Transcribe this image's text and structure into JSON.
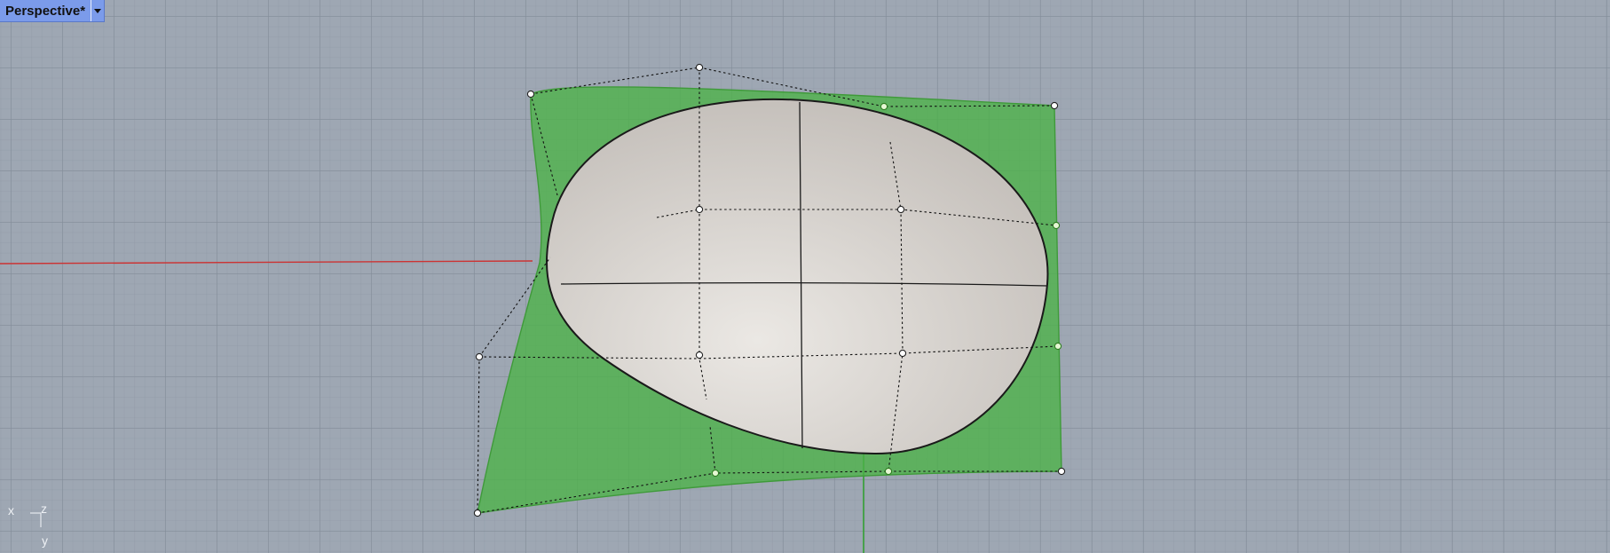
{
  "viewport": {
    "title": "Perspective*",
    "dropdown_icon": "caret-down-icon",
    "background": "#9ea7b3",
    "surface_color": "#5fac5c",
    "trimmed_surface_color": "#cbc6c1",
    "x_axis_color": "#cc3333",
    "y_axis_color": "#33a033"
  },
  "axes": {
    "x_label": "x",
    "z_label": "z",
    "y_label": "y"
  }
}
